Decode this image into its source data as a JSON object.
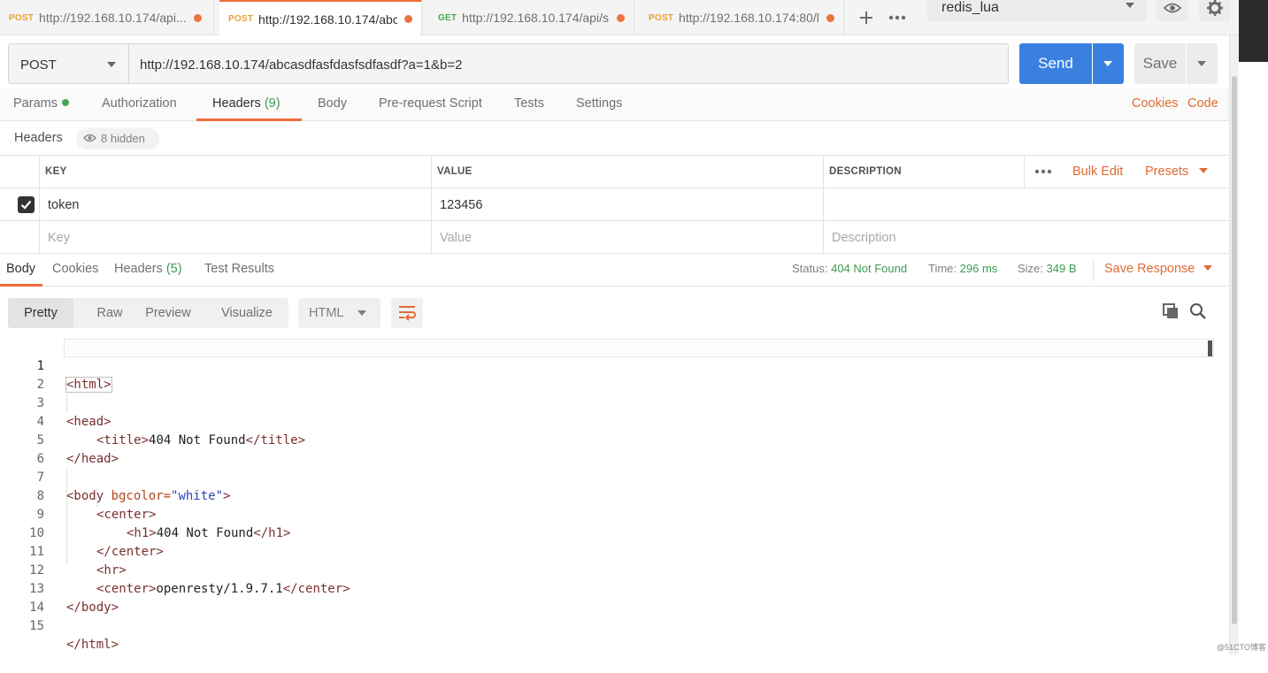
{
  "tabs": [
    {
      "method": "POST",
      "url": "http://192.168.10.174/api..."
    },
    {
      "method": "POST",
      "url": "http://192.168.10.174/abc..."
    },
    {
      "method": "GET",
      "url": "http://192.168.10.174/api/s..."
    },
    {
      "method": "POST",
      "url": "http://192.168.10.174:80/l..."
    }
  ],
  "environment": "redis_lua",
  "request": {
    "method": "POST",
    "url": "http://192.168.10.174/abcasdfasfdasfsdfasdf?a=1&b=2",
    "send_label": "Send",
    "save_label": "Save"
  },
  "request_tabs": {
    "params": "Params",
    "authorization": "Authorization",
    "headers": "Headers",
    "headers_count": "(9)",
    "body": "Body",
    "pre_request": "Pre-request Script",
    "tests": "Tests",
    "settings": "Settings",
    "cookies": "Cookies",
    "code": "Code"
  },
  "headers_section": {
    "label": "Headers",
    "hidden": "8 hidden",
    "columns": {
      "key": "KEY",
      "value": "VALUE",
      "description": "DESCRIPTION"
    },
    "bulk_edit": "Bulk Edit",
    "presets": "Presets",
    "rows": [
      {
        "key": "token",
        "value": "123456",
        "description": ""
      }
    ],
    "placeholders": {
      "key": "Key",
      "value": "Value",
      "description": "Description"
    }
  },
  "response": {
    "tabs": {
      "body": "Body",
      "cookies": "Cookies",
      "headers": "Headers",
      "headers_count": "(5)",
      "test_results": "Test Results"
    },
    "status_label": "Status:",
    "status": "404 Not Found",
    "time_label": "Time:",
    "time": "296 ms",
    "size_label": "Size:",
    "size": "349 B",
    "save_response": "Save Response",
    "formats": {
      "pretty": "Pretty",
      "raw": "Raw",
      "preview": "Preview",
      "visualize": "Visualize"
    },
    "language": "HTML"
  },
  "code_lines": [
    {
      "n": "1"
    },
    {
      "n": "2"
    },
    {
      "n": "3"
    },
    {
      "n": "4"
    },
    {
      "n": "5"
    },
    {
      "n": "6"
    },
    {
      "n": "7"
    },
    {
      "n": "8"
    },
    {
      "n": "9"
    },
    {
      "n": "10"
    },
    {
      "n": "11"
    },
    {
      "n": "12"
    },
    {
      "n": "13"
    },
    {
      "n": "14"
    },
    {
      "n": "15"
    }
  ],
  "code_tokens": {
    "l1": "<html>",
    "l3": "<head>",
    "l4a": "<title>",
    "l4b": "404 Not Found",
    "l4c": "</title>",
    "l5": "</head>",
    "l7a": "<body ",
    "l7b": "bgcolor=",
    "l7c": "\"white\"",
    "l7d": ">",
    "l8": "<center>",
    "l9a": "<h1>",
    "l9b": "404 Not Found",
    "l9c": "</h1>",
    "l10": "</center>",
    "l11": "<hr>",
    "l12a": "<center>",
    "l12b": "openresty/1.9.7.1",
    "l12c": "</center>",
    "l13": "</body>",
    "l15": "</html>"
  },
  "watermark": "@51CTO博客",
  "colors": {
    "accent": "#f26b3a",
    "send": "#3a80e0",
    "status_ok": "#3d9a53"
  }
}
